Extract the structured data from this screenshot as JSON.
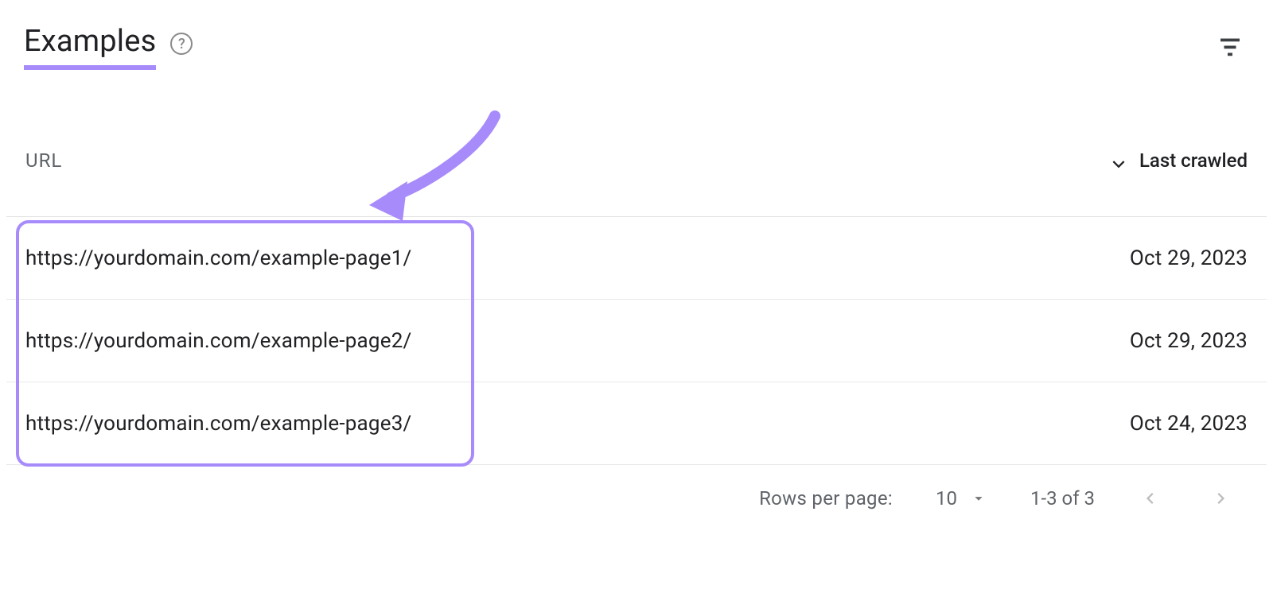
{
  "header": {
    "title": "Examples"
  },
  "columns": {
    "url": "URL",
    "lastCrawled": "Last crawled"
  },
  "rows": [
    {
      "url": "https://yourdomain.com/example-page1/",
      "date": "Oct 29, 2023"
    },
    {
      "url": "https://yourdomain.com/example-page2/",
      "date": "Oct 29, 2023"
    },
    {
      "url": "https://yourdomain.com/example-page3/",
      "date": "Oct 24, 2023"
    }
  ],
  "pagination": {
    "rowsPerPageLabel": "Rows per page:",
    "rowsPerPageValue": "10",
    "range": "1-3 of 3"
  }
}
